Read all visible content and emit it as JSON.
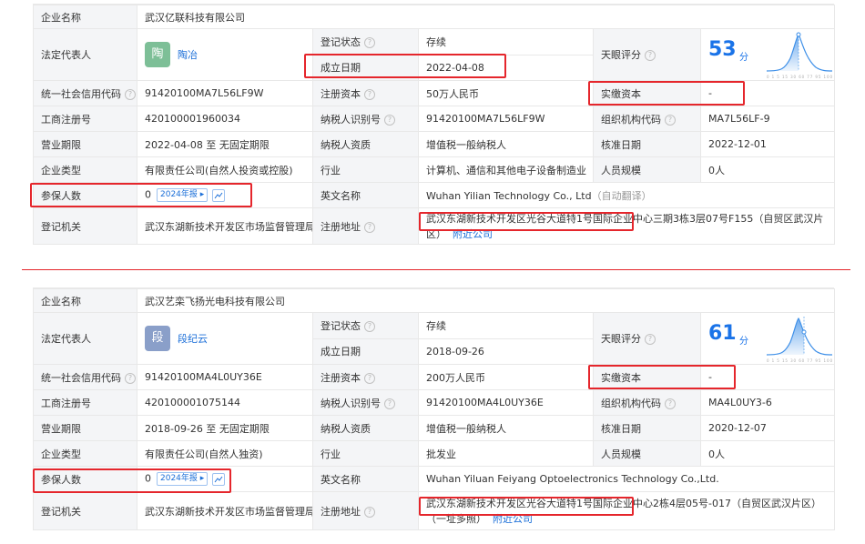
{
  "labels": {
    "company_name": "企业名称",
    "legal_rep": "法定代表人",
    "reg_status": "登记状态",
    "found_date": "成立日期",
    "tianyan_score": "天眼评分",
    "credit_code": "统一社会信用代码",
    "reg_capital": "注册资本",
    "paid_capital": "实缴资本",
    "biz_reg_no": "工商注册号",
    "taxpayer_id": "纳税人识别号",
    "org_code": "组织机构代码",
    "biz_term": "营业期限",
    "taxpayer_qual": "纳税人资质",
    "approval_date": "核准日期",
    "company_type": "企业类型",
    "industry": "行业",
    "staff_size": "人员规模",
    "insured": "参保人数",
    "english_name": "英文名称",
    "reg_authority": "登记机关",
    "reg_address": "注册地址"
  },
  "hint_glyph": "?",
  "score_unit": "分",
  "score_axis": "0 1 5 15 30 60 77 95 100",
  "companies": [
    {
      "company_name": "武汉亿联科技有限公司",
      "avatar_char": "陶",
      "avatar_color": "#7dbf97",
      "legal_rep": "陶冶",
      "reg_status": "存续",
      "found_date": "2022-04-08",
      "score": "53",
      "score_level": 0.53,
      "credit_code": "91420100MA7L56LF9W",
      "reg_capital": "50万人民币",
      "paid_capital": "-",
      "biz_reg_no": "420100001960034",
      "taxpayer_id": "91420100MA7L56LF9W",
      "org_code": "MA7L56LF-9",
      "biz_term": "2022-04-08 至 无固定期限",
      "taxpayer_qual": "增值税一般纳税人",
      "approval_date": "2022-12-01",
      "company_type": "有限责任公司(自然人投资或控股)",
      "industry": "计算机、通信和其他电子设备制造业",
      "staff_size": "0人",
      "insured": "0",
      "insured_badge": "2024年报",
      "english_name": "Wuhan Yilian Technology Co., Ltd",
      "english_note": "（自动翻译）",
      "reg_authority": "武汉东湖新技术开发区市场监督管理局",
      "reg_address_main": "武汉东湖新技术开发区光谷大道特1号国际企业中心",
      "reg_address_rest": "三期3栋3层07号F155（自贸区武汉片区）",
      "nearby_link": "附近公司"
    },
    {
      "company_name": "武汉艺栾飞扬光电科技有限公司",
      "avatar_char": "段",
      "avatar_color": "#8a9fc9",
      "legal_rep": "段纪云",
      "reg_status": "存续",
      "found_date": "2018-09-26",
      "score": "61",
      "score_level": 0.61,
      "credit_code": "91420100MA4L0UY36E",
      "reg_capital": "200万人民币",
      "paid_capital": "-",
      "biz_reg_no": "420100001075144",
      "taxpayer_id": "91420100MA4L0UY36E",
      "org_code": "MA4L0UY3-6",
      "biz_term": "2018-09-26 至 无固定期限",
      "taxpayer_qual": "增值税一般纳税人",
      "approval_date": "2020-12-07",
      "company_type": "有限责任公司(自然人独资)",
      "industry": "批发业",
      "staff_size": "0人",
      "insured": "0",
      "insured_badge": "2024年报",
      "english_name": "Wuhan Yiluan Feiyang Optoelectronics Technology Co.,Ltd.",
      "english_note": "",
      "reg_authority": "武汉东湖新技术开发区市场监督管理局",
      "reg_address_main": "武汉东湖新技术开发区光谷大道特1号国际企业中心",
      "reg_address_rest": "2栋4层05号-017（自贸区武汉片区）（一址多照）",
      "nearby_link": "附近公司"
    }
  ],
  "colors": {
    "highlight": "#e5262c",
    "score_blue": "#1a73e8",
    "status_green": "#27a36a",
    "link_blue": "#1a6ed8",
    "label_bg": "#f4f5f7"
  }
}
